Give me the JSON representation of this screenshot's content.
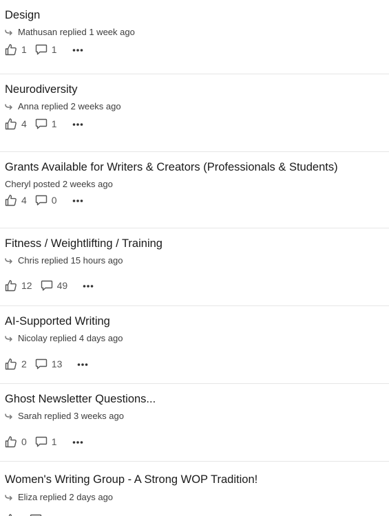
{
  "posts": [
    {
      "title": "Design",
      "meta": "Mathusan replied 1 week ago",
      "reply": true,
      "likes": "1",
      "comments": "1"
    },
    {
      "title": "Neurodiversity",
      "meta": "Anna replied 2 weeks ago",
      "reply": true,
      "likes": "4",
      "comments": "1"
    },
    {
      "title": "Grants Available for Writers & Creators (Professionals & Students)",
      "meta": "Cheryl posted 2 weeks ago",
      "reply": false,
      "likes": "4",
      "comments": "0"
    },
    {
      "title": "Fitness / Weightlifting / Training",
      "meta": "Chris replied 15 hours ago",
      "reply": true,
      "likes": "12",
      "comments": "49"
    },
    {
      "title": "AI-Supported Writing",
      "meta": "Nicolay replied 4 days ago",
      "reply": true,
      "likes": "2",
      "comments": "13"
    },
    {
      "title": "Ghost Newsletter Questions...",
      "meta": "Sarah replied 3 weeks ago",
      "reply": true,
      "likes": "0",
      "comments": "1"
    },
    {
      "title": "Women's Writing Group - A Strong WOP Tradition!",
      "meta": "Eliza replied 2 days ago",
      "reply": true,
      "likes": "",
      "comments": ""
    }
  ],
  "icons": {
    "reply": "reply-arrow-icon",
    "like": "thumbs-up-icon",
    "comment": "comment-bubble-icon",
    "more": "more-options-icon"
  },
  "colors": {
    "text": "#1a1a1a",
    "meta": "#3c3c3c",
    "icon": "#555555",
    "divider": "#e6e6e6"
  }
}
